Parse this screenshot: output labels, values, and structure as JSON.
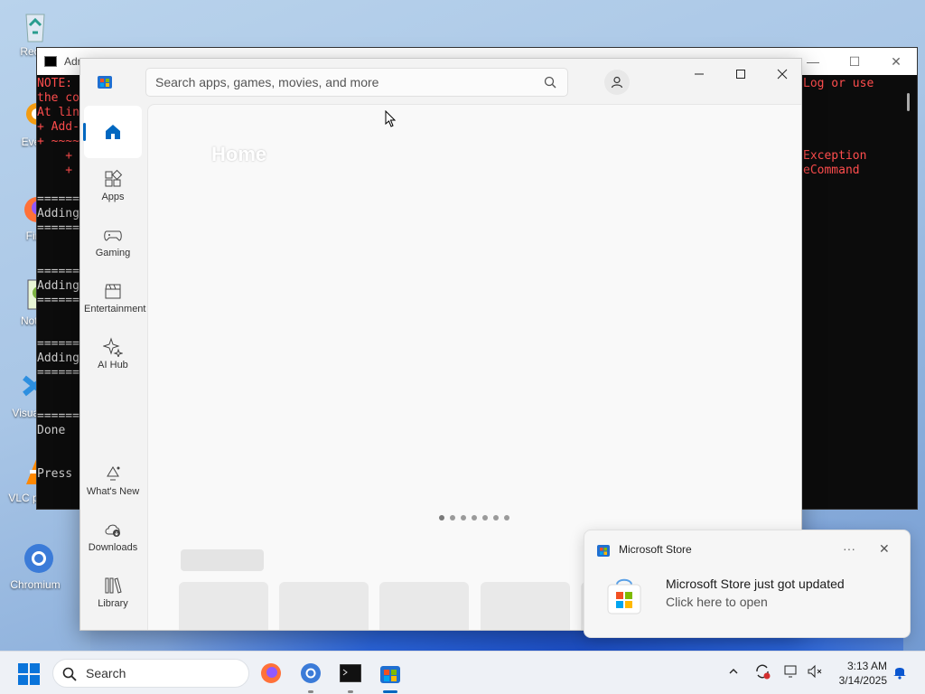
{
  "desktop": {
    "icons": [
      {
        "label": "Recyc"
      },
      {
        "label": "Every"
      },
      {
        "label": "Fire"
      },
      {
        "label": "Notep"
      },
      {
        "label": "Visual Co"
      },
      {
        "label": "VLC player"
      },
      {
        "label": "Chromium"
      }
    ]
  },
  "terminal": {
    "title": "Adr",
    "lines_left": [
      "NOTE:",
      "the co",
      "At lin",
      "+ Add-",
      "+ ~~~~~",
      "    +",
      "    +",
      "",
      "======",
      "Adding",
      "======",
      "",
      "",
      "======",
      "Adding",
      "======",
      "",
      "",
      "======",
      "Adding",
      "======",
      "",
      "",
      "======",
      "Done",
      "",
      "",
      "Press"
    ],
    "lines_right": [
      "Log or use",
      "",
      "",
      "",
      "",
      "Exception",
      "eCommand"
    ],
    "controls": {
      "minimize": "—",
      "maximize": "☐",
      "close": "✕"
    }
  },
  "store": {
    "search_placeholder": "Search apps, games, movies, and more",
    "nav": [
      {
        "label": ""
      },
      {
        "label": "Apps"
      },
      {
        "label": "Gaming"
      },
      {
        "label": "Entertainment"
      },
      {
        "label": "AI Hub"
      },
      {
        "label": "What's New"
      },
      {
        "label": "Downloads"
      },
      {
        "label": "Library"
      }
    ],
    "home_title": "Home",
    "carousel_pages": 7,
    "carousel_active": 1
  },
  "toast": {
    "app_name": "Microsoft Store",
    "more": "···",
    "close": "✕",
    "heading": "Microsoft Store just got updated",
    "subtext": "Click here to open"
  },
  "taskbar": {
    "search_label": "Search",
    "tray_chevron": "^",
    "time": "3:13 AM",
    "date": "3/14/2025"
  },
  "colors": {
    "accent": "#0067c0",
    "terminal_bg": "#0c0c0c",
    "terminal_error": "#ff4d4d"
  }
}
